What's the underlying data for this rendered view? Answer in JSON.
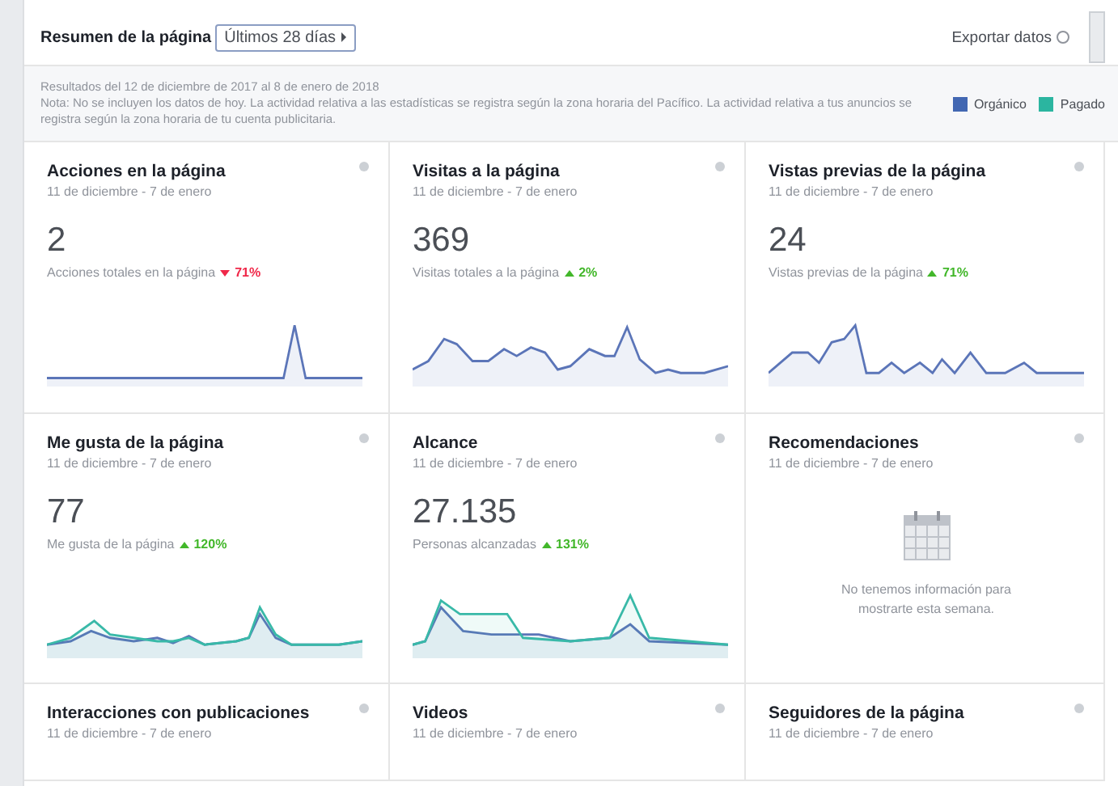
{
  "header": {
    "title": "Resumen de la página",
    "range_button": "Últimos 28 días",
    "export_link": "Exportar datos"
  },
  "note": {
    "lines": [
      "Resultados del 12 de diciembre de 2017 al 8 de enero de 2018",
      "Nota: No se incluyen los datos de hoy. La actividad relativa a las estadísticas se registra según la zona horaria del Pacífico. La actividad relativa a tus anuncios se registra según la zona horaria de tu cuenta publicitaria."
    ]
  },
  "legend": [
    {
      "label": "Orgánico",
      "color": "#4267b2"
    },
    {
      "label": "Pagado",
      "color": "#2bb5a0"
    }
  ],
  "cards": [
    {
      "kind": "metric",
      "title": "Acciones en la página",
      "date": "11 de diciembre - 7 de enero",
      "value": "2",
      "caption": "Acciones totales en la página",
      "decrease": true,
      "change": "71%"
    },
    {
      "kind": "metric",
      "title": "Visitas a la página",
      "date": "11 de diciembre - 7 de enero",
      "value": "369",
      "caption": "Visitas totales a la página",
      "decrease": false,
      "change": "2%"
    },
    {
      "kind": "metric",
      "title": "Vistas previas de la página",
      "date": "11 de diciembre - 7 de enero",
      "value": "24",
      "caption": "Vistas previas de la página",
      "decrease": false,
      "change": "71%"
    },
    {
      "kind": "metric",
      "title": "Me gusta de la página",
      "date": "11 de diciembre - 7 de enero",
      "value": "77",
      "caption": "Me gusta de la página",
      "decrease": false,
      "change": "120%"
    },
    {
      "kind": "metric",
      "title": "Alcance",
      "date": "11 de diciembre - 7 de enero",
      "value": "27.135",
      "caption": "Personas alcanzadas",
      "decrease": false,
      "change": "131%"
    },
    {
      "kind": "empty",
      "title": "Recomendaciones",
      "date": "11 de diciembre - 7 de enero",
      "message": "No tenemos información para mostrarte esta semana."
    },
    {
      "kind": "metric",
      "title": "Interacciones con publicaciones",
      "date": "11 de diciembre - 7 de enero"
    },
    {
      "kind": "metric",
      "title": "Videos",
      "date": "11 de diciembre - 7 de enero"
    },
    {
      "kind": "metric",
      "title": "Seguidores de la página",
      "date": "11 de diciembre - 7 de enero"
    }
  ]
}
